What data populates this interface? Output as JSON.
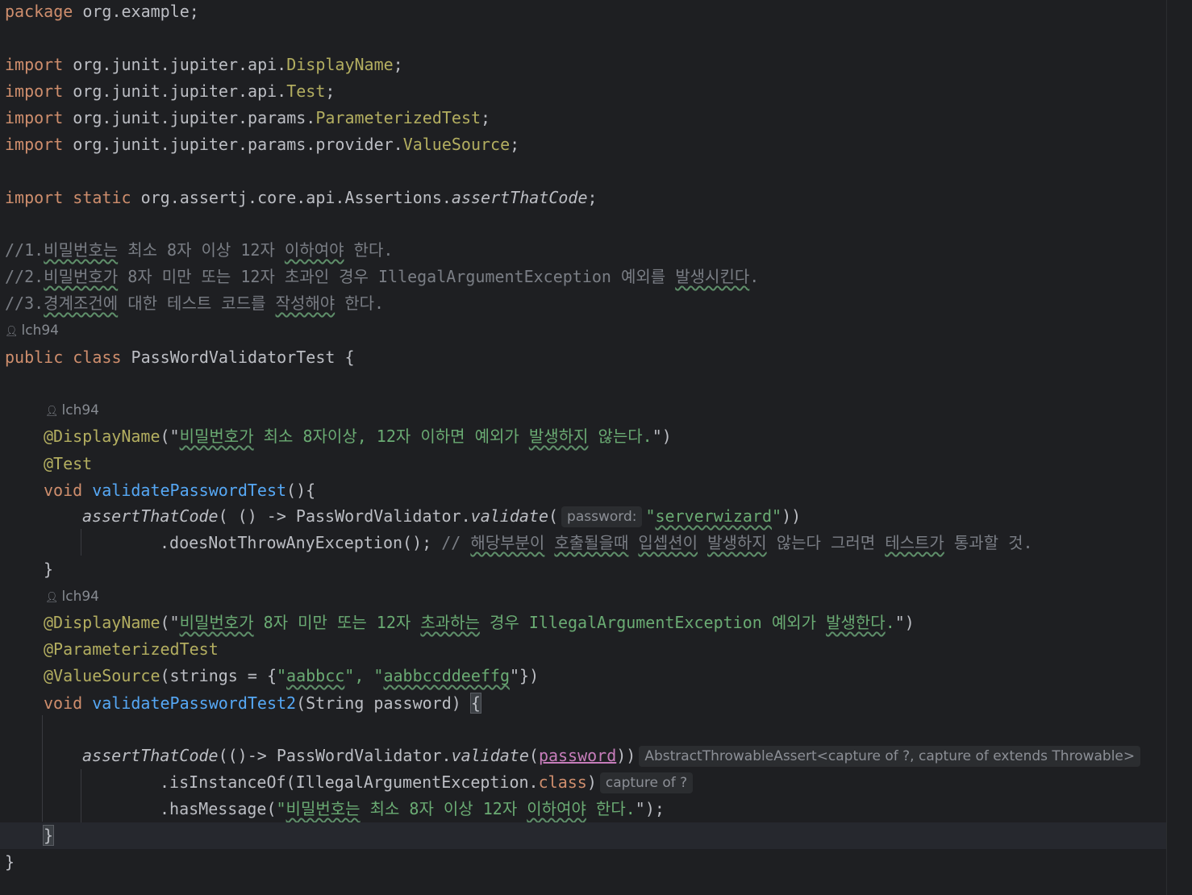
{
  "code": {
    "package_kw": "package",
    "package_name": " org.example;",
    "import_kw": "import",
    "imports": [
      {
        "path": " org.junit.jupiter.api.",
        "name": "DisplayName"
      },
      {
        "path": " org.junit.jupiter.api.",
        "name": "Test"
      },
      {
        "path": " org.junit.jupiter.params.",
        "name": "ParameterizedTest"
      },
      {
        "path": " org.junit.jupiter.params.provider.",
        "name": "ValueSource"
      }
    ],
    "static_kw": " static",
    "static_path": " org.assertj.core.api.Assertions.",
    "static_name": "assertThatCode",
    "semicolon": ";",
    "comments": [
      {
        "prefix": "//1.",
        "parts": [
          "비밀번호는",
          " 최소 8자 이상 12자 ",
          "이하여야",
          " 한다."
        ]
      },
      {
        "prefix": "//2.",
        "parts": [
          "비밀번호가",
          " 8자 미만 또는 12자 초과인 경우 IllegalArgumentException 예외를 ",
          "발생시킨다",
          "."
        ]
      },
      {
        "prefix": "//3.",
        "parts": [
          "경계조건에",
          " 대한 테스트 코드를 ",
          "작성해야",
          " 한다."
        ]
      }
    ],
    "author": "lch94",
    "public_kw": "public",
    "class_kw": " class",
    "class_name": " PassWordValidatorTest {",
    "method1": {
      "annotation": "@DisplayName",
      "display_open": "(\"",
      "display_parts": [
        "비밀번호가",
        " 최소 8자이상, 12자 이하면 예외가 ",
        "발생하지",
        " 않는다."
      ],
      "display_close": "\")",
      "test_annotation": "@Test",
      "void_kw": "void",
      "name": " validatePasswordTest",
      "sig_rest": "(){",
      "assert_fn": "assertThatCode",
      "assert_mid": "( () -> PassWordValidator.",
      "validate_fn": "validate",
      "open_paren": "(",
      "hint": "password:",
      "arg_q1": "\"",
      "arg": "serverwizard",
      "arg_q2": "\"",
      "close": "))",
      "chain": ".doesNotThrowAnyException(); ",
      "comment_parts": [
        "// ",
        "해당부분이",
        " ",
        "호출될을때",
        " ",
        "입셉션이",
        " ",
        "발생하지",
        " 않는다 그러면 ",
        "테스트가",
        " 통과할 것."
      ],
      "close_brace": "}"
    },
    "method2": {
      "annotation": "@DisplayName",
      "display_open": "(\"",
      "display_parts": [
        "비밀번호가",
        " 8자 미만 또는 12자 ",
        "초과하는",
        " 경우 IllegalArgumentException 예외가 ",
        "발생한다",
        "."
      ],
      "display_close": "\")",
      "param_annotation": "@ParameterizedTest",
      "value_annotation": "@ValueSource",
      "value_open": "(strings = {",
      "value1_q": "\"",
      "value1": "aabbcc",
      "value_sep": "\", ",
      "value2_q": "\"",
      "value2": "aabbccddeeffg",
      "value_close": "\"})",
      "void_kw": "void",
      "name": " validatePasswordTest2",
      "sig_rest": "(String password) ",
      "open_brace": "{",
      "assert_fn": "assertThatCode",
      "assert_mid": "(()-> PassWordValidator.",
      "validate_fn": "validate",
      "open_paren": "(",
      "param": "password",
      "close": "))",
      "hint_type": "AbstractThrowableAssert<capture of ?, capture of extends Throwable>",
      "chain1": ".isInstanceOf(IllegalArgumentException.",
      "class_kw": "class",
      "chain1_close": ")",
      "hint_capture": "capture of ?",
      "chain2_open": ".hasMessage(",
      "msg_q1": "\"",
      "msg_parts": [
        "비밀번호는",
        " 최소 8자 이상 12자 ",
        "이하여야",
        " 한다."
      ],
      "msg_close": "\");",
      "close_brace": "}"
    },
    "class_close": "}"
  }
}
